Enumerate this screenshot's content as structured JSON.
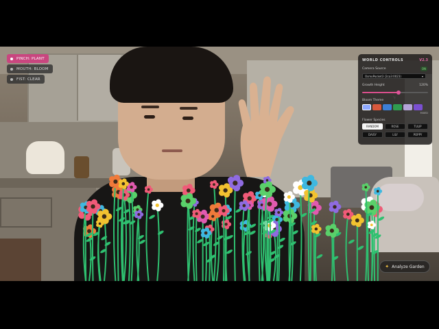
{
  "gestures": [
    {
      "label": "PINCH: PLANT",
      "active": true
    },
    {
      "label": "MOUTH: BLOOM",
      "active": false
    },
    {
      "label": "FIST: CLEAR",
      "active": false
    }
  ],
  "panel": {
    "title": "WORLD CONTROLS",
    "version": "V2.3",
    "camera_label": "Camera Source",
    "camera_status": "ON",
    "camera_value": "OsmoPocket3 (2ca3:0023)",
    "growth_label": "Growth Height",
    "growth_value": "120%",
    "growth_level": 0.55,
    "theme_label": "Bloom Theme",
    "theme_swatches": [
      "#8fa9ff",
      "#d9583c",
      "#3d7fd6",
      "#2f9c4f",
      "#b4a3d8",
      "#7a4fd1"
    ],
    "theme_selected_index": 0,
    "theme_mixed_label": "MIXED",
    "species_label": "Flower Species",
    "species": [
      "RANDOM",
      "ROSE",
      "TULIP",
      "DAISY",
      "LILY",
      "POPPY"
    ],
    "species_selected_index": 0
  },
  "analyze_button": {
    "label": "Analyze Garden",
    "icon": "sparkle-icon"
  },
  "colors": {
    "accent": "#d94f8c",
    "stem": "#2fc070"
  }
}
